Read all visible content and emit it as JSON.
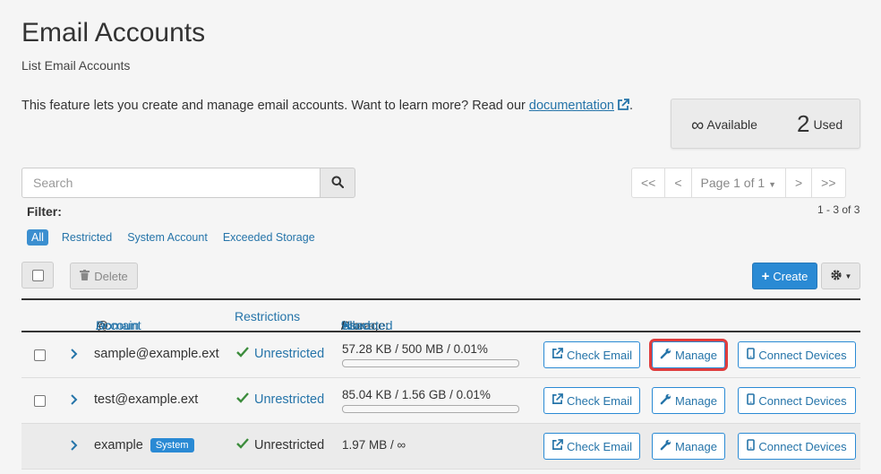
{
  "page": {
    "title": "Email Accounts",
    "subtitle": "List Email Accounts",
    "description_prefix": "This feature lets you create and manage email accounts. Want to learn more? Read our ",
    "documentation_link": "documentation",
    "description_suffix": "."
  },
  "stats": {
    "available_symbol": "∞",
    "available_label": "Available",
    "used_count": "2",
    "used_label": "Used"
  },
  "search": {
    "placeholder": "Search"
  },
  "pagination": {
    "first": "<<",
    "prev": "<",
    "page_label": "Page 1 of 1",
    "next": ">",
    "last": ">>",
    "range": "1 - 3 of 3"
  },
  "filter": {
    "label": "Filter:",
    "options": [
      "All",
      "Restricted",
      "System Account",
      "Exceeded Storage"
    ],
    "active": "All"
  },
  "toolbar": {
    "delete_label": "Delete",
    "create_label": "Create"
  },
  "table": {
    "headers": {
      "account": "Account",
      "at": "@",
      "domain": "Domain",
      "restrictions": "Restrictions",
      "storage": "Storage:",
      "used": "Used",
      "sep1": "/",
      "allocated": "Allocated",
      "sep2": "/",
      "percent": "%"
    },
    "rows": [
      {
        "email": "sample@example.ext",
        "restriction": "Unrestricted",
        "storage": "57.28 KB / 500 MB / 0.01%",
        "usage_fraction": 0.0001,
        "check_label": "Check Email",
        "manage_label": "Manage",
        "connect_label": "Connect Devices"
      },
      {
        "email": "test@example.ext",
        "restriction": "Unrestricted",
        "storage": "85.04 KB / 1.56 GB / 0.01%",
        "usage_fraction": 0.0001,
        "check_label": "Check Email",
        "manage_label": "Manage",
        "connect_label": "Connect Devices"
      },
      {
        "email": "example",
        "badge": "System",
        "restriction": "Unrestricted",
        "storage": "1.97 MB / ∞",
        "check_label": "Check Email",
        "manage_label": "Manage",
        "connect_label": "Connect Devices"
      }
    ]
  },
  "colors": {
    "link": "#2574a9",
    "primary": "#2a8ad4",
    "success": "#3c8c3c",
    "highlight": "#e03c3c"
  }
}
